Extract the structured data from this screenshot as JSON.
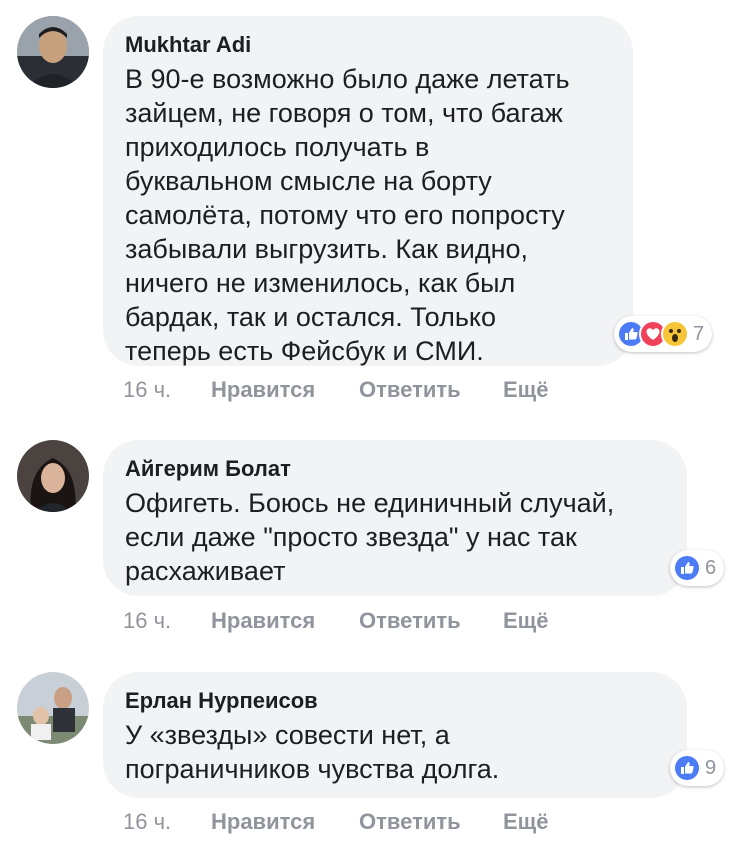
{
  "comments": [
    {
      "author": "Mukhtar Adi",
      "text": "В 90-е возможно было даже летать\nзайцем, не говоря о том, что багаж\nприходилось получать в\nбуквальном смысле на борту\nсамолёта, потому что его попросту\nзабывали выгрузить. Как видно,\nничего не изменилось, как был\nбардак, так и остался. Только\nтеперь есть Фейсбук и СМИ.",
      "reaction_icons": [
        "like-icon",
        "love-icon",
        "wow-icon"
      ],
      "reaction_count": "7",
      "time": "16 ч.",
      "like_label": "Нравится",
      "reply_label": "Ответить",
      "more_label": "Ещё"
    },
    {
      "author": "Айгерим Болат",
      "text": "Офигеть. Боюсь не единичный случай,\nесли даже \"просто звезда\" у нас так\nрасхаживает",
      "reaction_icons": [
        "like-icon"
      ],
      "reaction_count": "6",
      "time": "16 ч.",
      "like_label": "Нравится",
      "reply_label": "Ответить",
      "more_label": "Ещё"
    },
    {
      "author": "Ерлан Нурпеисов",
      "text": "У «звезды» совести нет, а\nпограничников чувства долга.",
      "reaction_icons": [
        "like-icon"
      ],
      "reaction_count": "9",
      "time": "16 ч.",
      "like_label": "Нравится",
      "reply_label": "Ответить",
      "more_label": "Ещё"
    }
  ],
  "colors": {
    "bubble": "#f2f3f5",
    "like": "#4b7bf5",
    "love": "#f0425b",
    "wow": "#f7c538",
    "meta_text": "#90949c"
  }
}
